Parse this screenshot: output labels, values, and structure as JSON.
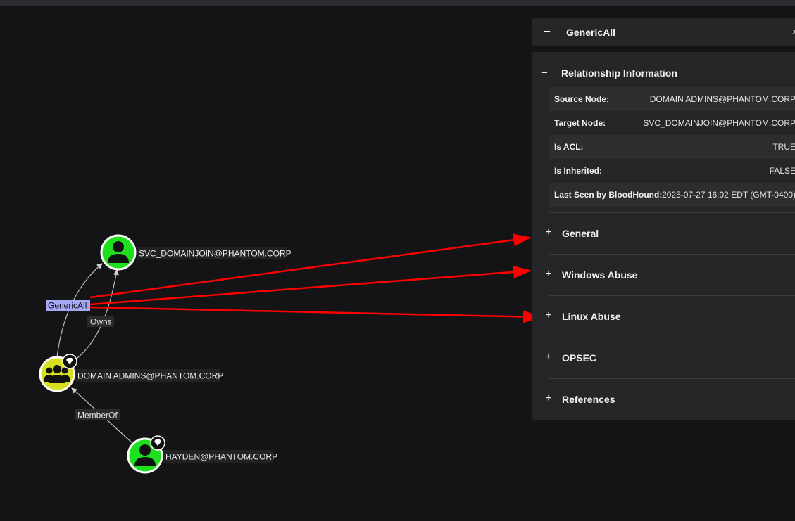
{
  "graph": {
    "nodes": {
      "svc": {
        "label": "SVC_DOMAINJOIN@PHANTOM.CORP",
        "icon": "user-icon",
        "color": "#1fe01f"
      },
      "domain_admins": {
        "label": "DOMAIN ADMINS@PHANTOM.CORP",
        "icon": "group-icon",
        "color": "#d6e01f"
      },
      "hayden": {
        "label": "HAYDEN@PHANTOM.CORP",
        "icon": "user-icon",
        "color": "#1fe01f"
      }
    },
    "edges": {
      "generic_all": "GenericAll",
      "owns": "Owns",
      "member_of": "MemberOf"
    }
  },
  "panel": {
    "header_title": "GenericAll",
    "collapse_symbol": "−",
    "close_symbol": "×",
    "relationship": {
      "title": "Relationship Information",
      "symbol": "−",
      "rows": [
        {
          "key": "Source Node:",
          "value": "DOMAIN ADMINS@PHANTOM.CORP"
        },
        {
          "key": "Target Node:",
          "value": "SVC_DOMAINJOIN@PHANTOM.CORP"
        },
        {
          "key": "Is ACL:",
          "value": "TRUE"
        },
        {
          "key": "Is Inherited:",
          "value": "FALSE"
        },
        {
          "key": "Last Seen by BloodHound:",
          "value": "2025-07-27 16:02 EDT (GMT-0400)"
        }
      ]
    },
    "sections": [
      {
        "label": "General",
        "symbol": "+"
      },
      {
        "label": "Windows Abuse",
        "symbol": "+"
      },
      {
        "label": "Linux Abuse",
        "symbol": "+"
      },
      {
        "label": "OPSEC",
        "symbol": "+"
      },
      {
        "label": "References",
        "symbol": "+"
      }
    ]
  },
  "colors": {
    "annotation_arrow": "#ff0000",
    "edge_label_highlight": "#a4a8f5",
    "background": "#141416",
    "panel": "#262628"
  }
}
